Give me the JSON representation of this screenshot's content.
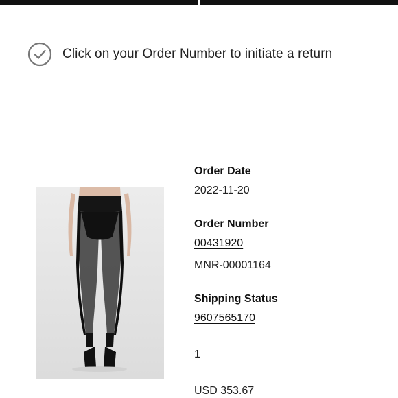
{
  "notice": {
    "icon": "check-circle-icon",
    "message": "Click on your Order Number to initiate a return"
  },
  "product": {
    "image_icon": "product-photo-leggings"
  },
  "order": {
    "date_label": "Order Date",
    "date_value": "2022-11-20",
    "number_label": "Order Number",
    "number_value": "00431920",
    "return_number": "MNR-00001164",
    "shipping_label": "Shipping Status",
    "tracking_number": "9607565170",
    "quantity": "1",
    "price": "USD 353.67"
  },
  "colors": {
    "top_bar": "#111111",
    "icon_stroke": "#777777",
    "text": "#222222"
  }
}
